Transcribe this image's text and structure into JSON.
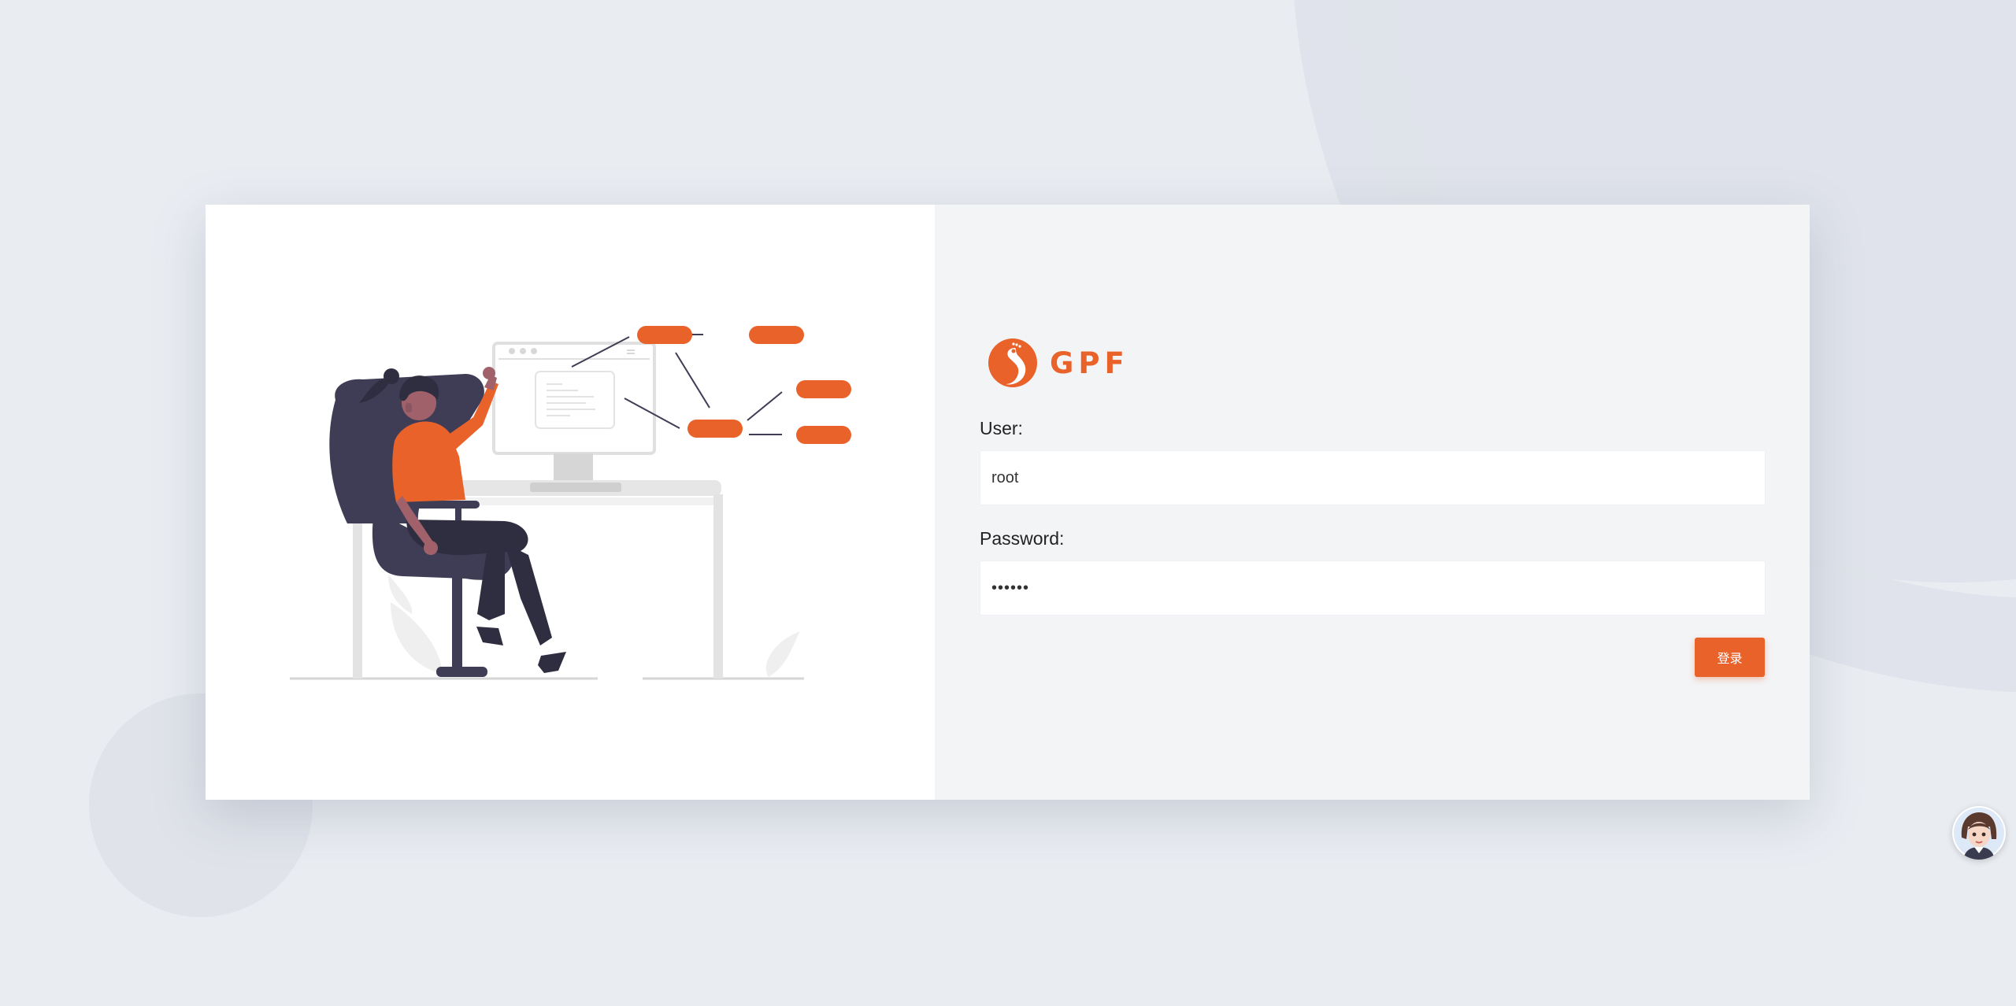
{
  "brand": {
    "name": "GPF",
    "logo_icon": "peacock-logo-icon",
    "accent_color": "#e8622a"
  },
  "illustration": {
    "icon": "woman-at-desk-flowchart-illustration"
  },
  "login_form": {
    "user_label": "User:",
    "user_value": "root",
    "password_label": "Password:",
    "password_value": "••••••",
    "submit_label": "登录"
  },
  "assistant": {
    "icon": "assistant-avatar-icon"
  }
}
